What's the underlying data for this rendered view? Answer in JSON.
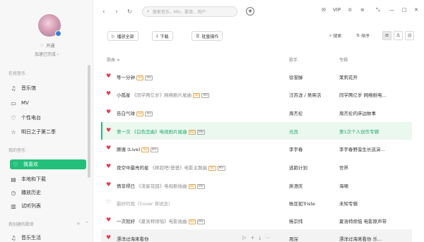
{
  "profile": {
    "vip_label": "开通",
    "speed_label": "加速已完成 ›"
  },
  "sidebar": {
    "online_title": "在线音乐",
    "online_items": [
      {
        "label": "音乐馆",
        "icon": "music-hall-icon"
      },
      {
        "label": "MV",
        "icon": "mv-icon"
      },
      {
        "label": "个性电台",
        "icon": "radio-icon"
      },
      {
        "label": "明日之子第二季",
        "icon": "star-icon"
      }
    ],
    "my_title": "我的音乐",
    "my_items": [
      {
        "label": "我喜欢",
        "icon": "heart-icon"
      },
      {
        "label": "本地和下载",
        "icon": "local-download-icon"
      },
      {
        "label": "播放历史",
        "icon": "history-icon"
      },
      {
        "label": "试听列表",
        "icon": "trial-list-icon"
      }
    ],
    "created_title": "我创建的歌单",
    "created_items": [
      {
        "label": "音乐生活",
        "icon": "playlist-icon"
      }
    ]
  },
  "topbar": {
    "search_placeholder": "搜索音乐、MV、歌单、用户",
    "vip": "VIP"
  },
  "toolbar": {
    "play_all": "播放全部",
    "download": "下载",
    "batch": "批量操作",
    "search": "搜索",
    "sort": "排序"
  },
  "table": {
    "headers": {
      "title": "歌曲 ≑",
      "artist": "歌手",
      "album": "专辑"
    },
    "rows": [
      {
        "title": "等一分钟",
        "sub": "",
        "tags": [
          "SQ",
          "MV"
        ],
        "artist": "徐誉滕",
        "album": "茉莉花开",
        "liked": true
      },
      {
        "title": "小孤星",
        "sub": "《同学两亿岁》网络剧片尾曲",
        "tags": [
          "SQ",
          "MV"
        ],
        "artist": "汪苏泷 / 吴映洁",
        "album": "同学两亿岁 网络剧电...",
        "liked": true
      },
      {
        "title": "告白气球",
        "sub": "",
        "tags": [
          "SQ",
          "MV"
        ],
        "artist": "周杰伦",
        "album": "周杰伦的床边故事",
        "liked": true
      },
      {
        "title": "第一次",
        "sub": "《白色恋曲》电视剧片尾曲",
        "tags": [
          "SQ",
          "MV"
        ],
        "artist": "光良",
        "album": "第1次个人创作专辑",
        "liked": true
      },
      {
        "title": "厮缠 (Live)",
        "sub": "",
        "tags": [
          "SQ",
          "MV"
        ],
        "artist": "李宇春",
        "album": "李宇春野蛮生长巡演...",
        "liked": true
      },
      {
        "title": "夜空中最亮的星",
        "sub": "《摔跤吧!爸爸》电影主题曲",
        "tags": [
          "SQ",
          "MV"
        ],
        "artist": "逃跑计划",
        "album": "世界",
        "liked": true
      },
      {
        "title": "情非得已",
        "sub": "《流星花园》电视剧插曲",
        "tags": [
          "SQ",
          "MV"
        ],
        "artist": "庾澄庆",
        "album": "海啸",
        "liked": true
      },
      {
        "title": "最好的我（Cover 蒋锐丞）",
        "sub": "",
        "tags": [],
        "artist": "杨亚如Triste",
        "album": "未知专辑",
        "liked": false
      },
      {
        "title": "一次就好",
        "sub": "《夏洛特烦恼》电影插曲",
        "tags": [
          "SQ",
          "MV"
        ],
        "artist": "杨宗纬",
        "album": "夏洛特烦恼 电影原声带",
        "liked": true
      },
      {
        "title": "漂洋过海来看你",
        "sub": "",
        "tags": [],
        "artist": "周深",
        "album": "漂洋过海来看你 乐...",
        "liked": true
      }
    ]
  }
}
